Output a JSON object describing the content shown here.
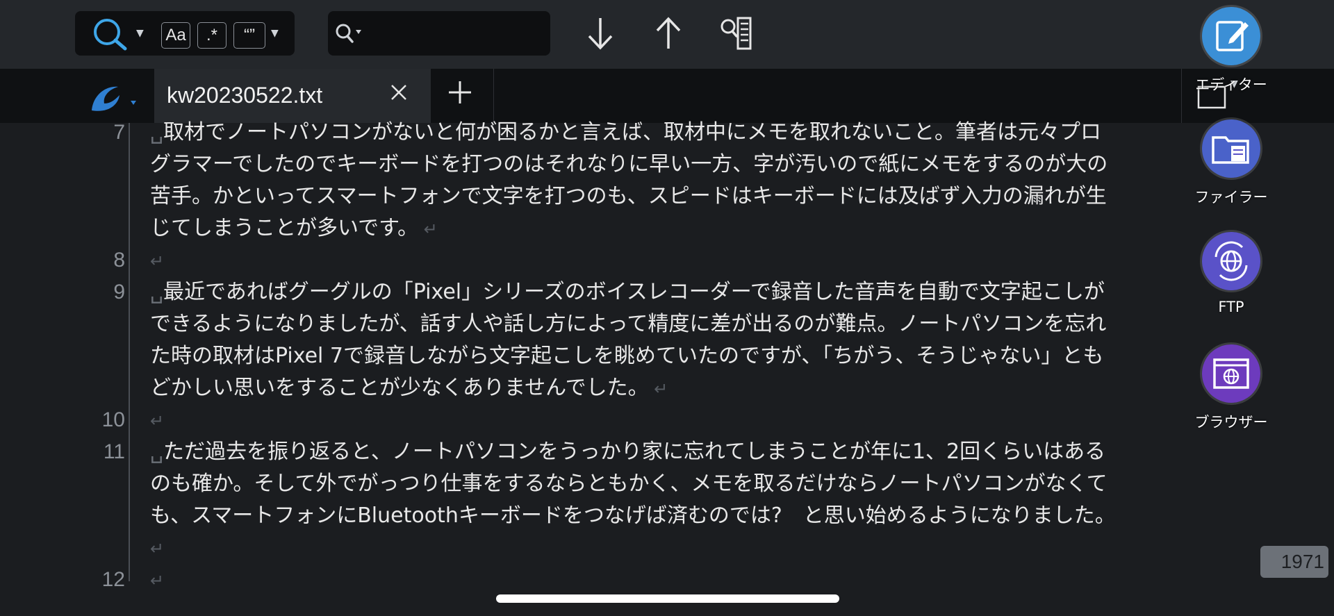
{
  "toolbar": {
    "case_label": "Aa",
    "regex_label": ".*",
    "quote_label": "“”",
    "find_value": "",
    "find_placeholder": ""
  },
  "tabs": [
    {
      "label": "kw20230522.txt"
    }
  ],
  "fabs": [
    {
      "label": "エディター",
      "icon": "edit-icon",
      "color": "#3b8fd6"
    },
    {
      "label": "ファイラー",
      "icon": "folder-icon",
      "color": "#4a62c9"
    },
    {
      "label": "FTP",
      "icon": "ftp-globe-icon",
      "color": "#5a52c8"
    },
    {
      "label": "ブラウザー",
      "icon": "browser-icon",
      "color": "#6d3bbd"
    }
  ],
  "editor": {
    "lines": [
      {
        "num": "7",
        "rows": [
          "取材でノートパソコンがないと何が困るかと言えば、取材中にメモを取れないこと。筆者は元々プロ",
          "グラマーでしたのでキーボードを打つのはそれなりに早い一方、字が汚いので紙にメモをするのが大の",
          "苦手。かといってスマートフォンで文字を打つのも、スピードはキーボードには及ばず入力の漏れが生",
          "じてしまうことが多いです。"
        ]
      },
      {
        "num": "8",
        "rows": [
          ""
        ]
      },
      {
        "num": "9",
        "rows": [
          "最近であればグーグルの「Pixel」シリーズのボイスレコーダーで録音した音声を自動で文字起こしが",
          "できるようになりましたが、話す人や話し方によって精度に差が出るのが難点。ノートパソコンを忘れ",
          "た時の取材はPixel 7で録音しながら文字起こしを眺めていたのですが、「ちがう、そうじゃない」とも",
          "どかしい思いをすることが少なくありませんでした。"
        ]
      },
      {
        "num": "10",
        "rows": [
          ""
        ]
      },
      {
        "num": "11",
        "rows": [
          "ただ過去を振り返ると、ノートパソコンをうっかり家に忘れてしまうことが年に1、2回くらいはある",
          "のも確か。そして外でがっつり仕事をするならともかく、メモを取るだけならノートパソコンがなくて",
          "も、スマートフォンにBluetoothキーボードをつなげば済むのでは?　と思い始めるようになりました。",
          ""
        ]
      },
      {
        "num": "12",
        "rows": [
          ""
        ]
      }
    ]
  },
  "status": {
    "char_count": "1971"
  },
  "colors": {
    "background": "#1b1d20",
    "toolbar": "#24272b",
    "tab_active": "#26292d",
    "accent_logo": "#2f7fd1"
  }
}
